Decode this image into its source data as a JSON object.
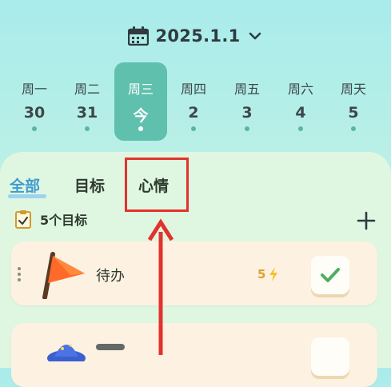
{
  "header": {
    "date": "2025.1.1"
  },
  "week": [
    {
      "name": "周一",
      "num": "30"
    },
    {
      "name": "周二",
      "num": "31"
    },
    {
      "name": "周三",
      "num": "今",
      "selected": true
    },
    {
      "name": "周四",
      "num": "2"
    },
    {
      "name": "周五",
      "num": "3"
    },
    {
      "name": "周六",
      "num": "4"
    },
    {
      "name": "周天",
      "num": "5"
    }
  ],
  "tabs": {
    "all": "全部",
    "goal": "目标",
    "mood": "心情"
  },
  "goals": {
    "count_label": "5个目标"
  },
  "cards": [
    {
      "title": "待办",
      "energy": "5",
      "icon": "flag-icon"
    },
    {
      "title": "",
      "energy": "",
      "icon": "wizard-hat-icon"
    }
  ],
  "colors": {
    "accent": "#5fc0ad",
    "highlight": "#e3322e",
    "tab_active": "#3f9bd0"
  }
}
